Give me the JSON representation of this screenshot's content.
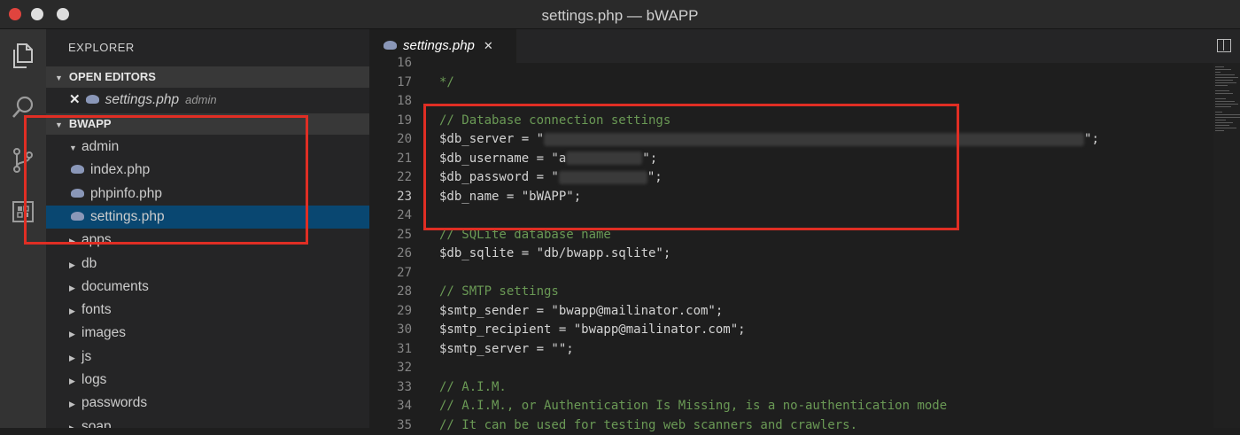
{
  "window": {
    "title": "settings.php — bWAPP"
  },
  "sidebar": {
    "title": "EXPLORER",
    "open_editors": {
      "header": "OPEN EDITORS",
      "items": [
        {
          "name": "settings.php",
          "description": "admin"
        }
      ]
    },
    "project": {
      "header": "BWAPP",
      "tree": [
        {
          "label": "admin",
          "type": "folder",
          "expanded": true
        },
        {
          "label": "index.php",
          "type": "file"
        },
        {
          "label": "phpinfo.php",
          "type": "file"
        },
        {
          "label": "settings.php",
          "type": "file",
          "selected": true
        },
        {
          "label": "apps",
          "type": "folder"
        },
        {
          "label": "db",
          "type": "folder"
        },
        {
          "label": "documents",
          "type": "folder"
        },
        {
          "label": "fonts",
          "type": "folder"
        },
        {
          "label": "images",
          "type": "folder"
        },
        {
          "label": "js",
          "type": "folder"
        },
        {
          "label": "logs",
          "type": "folder"
        },
        {
          "label": "passwords",
          "type": "folder"
        },
        {
          "label": "soap",
          "type": "folder"
        }
      ]
    }
  },
  "editor": {
    "tab": {
      "label": "settings.php"
    },
    "active_line": 23,
    "lines": [
      {
        "n": 16,
        "text": ""
      },
      {
        "n": 17,
        "text": "*/"
      },
      {
        "n": 18,
        "text": ""
      },
      {
        "n": 19,
        "text": "// Database connection settings"
      },
      {
        "n": 20,
        "text": "$db_server = \"",
        "redacted": true,
        "after": "\";"
      },
      {
        "n": 21,
        "text": "$db_username = \"a",
        "redacted": true,
        "after": "\";"
      },
      {
        "n": 22,
        "text": "$db_password = \"",
        "redacted": true,
        "after": "\";"
      },
      {
        "n": 23,
        "text": "$db_name = \"bWAPP\";"
      },
      {
        "n": 24,
        "text": ""
      },
      {
        "n": 25,
        "text": "// SQLite database name"
      },
      {
        "n": 26,
        "text": "$db_sqlite = \"db/bwapp.sqlite\";"
      },
      {
        "n": 27,
        "text": ""
      },
      {
        "n": 28,
        "text": "// SMTP settings"
      },
      {
        "n": 29,
        "text": "$smtp_sender = \"bwapp@mailinator.com\";"
      },
      {
        "n": 30,
        "text": "$smtp_recipient = \"bwapp@mailinator.com\";"
      },
      {
        "n": 31,
        "text": "$smtp_server = \"\";"
      },
      {
        "n": 32,
        "text": ""
      },
      {
        "n": 33,
        "text": "// A.I.M."
      },
      {
        "n": 34,
        "text": "// A.I.M., or Authentication Is Missing, is a no-authentication mode"
      },
      {
        "n": 35,
        "text": "// It can be used for testing web scanners and crawlers."
      }
    ]
  },
  "colors": {
    "comment": "#6a9955",
    "annotation": "#e02e24",
    "selection": "#094771"
  }
}
